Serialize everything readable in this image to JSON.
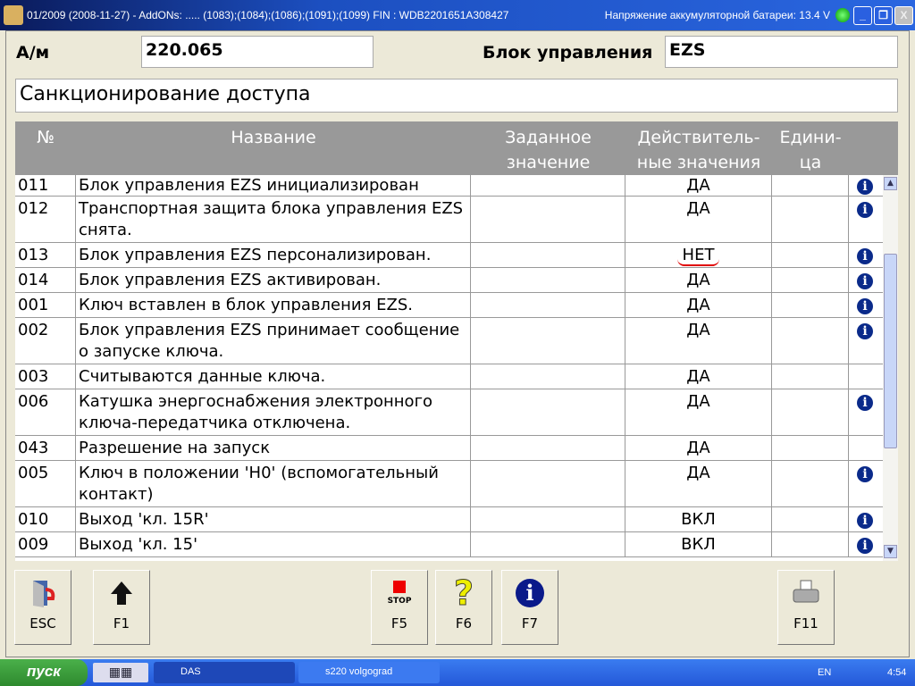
{
  "window": {
    "title": "01/2009 (2008-11-27) - AddONs: ..... (1083);(1084);(1086);(1091);(1099)  FIN : WDB2201651A308427",
    "battery": "Напряжение аккумуляторной батареи: 13.4 V"
  },
  "header": {
    "am_label": "А/м",
    "am_value": "220.065",
    "ecu_label": "Блок управления",
    "ecu_value": "EZS",
    "section": "Санкционирование доступа"
  },
  "table": {
    "columns": [
      "№",
      "Название",
      "Заданное значение",
      "Действитель-ные значения",
      "Едини-ца"
    ],
    "col_lines": [
      [
        "№"
      ],
      [
        "Название"
      ],
      [
        "Заданное",
        "значение"
      ],
      [
        "Действитель-",
        "ные значения"
      ],
      [
        "Едини-",
        "ца"
      ]
    ],
    "rows": [
      {
        "no": "011",
        "name": "Блок управления EZS инициализирован",
        "set": "",
        "actual": "ДА",
        "unit": "",
        "info": true
      },
      {
        "no": "012",
        "name": "Транспортная защита блока управления EZS снята.",
        "set": "",
        "actual": "ДА",
        "unit": "",
        "info": true
      },
      {
        "no": "013",
        "name": "Блок управления EZS персонализирован.",
        "set": "",
        "actual": "НЕТ",
        "unit": "",
        "info": true,
        "marked": true
      },
      {
        "no": "014",
        "name": "Блок управления EZS активирован.",
        "set": "",
        "actual": "ДА",
        "unit": "",
        "info": true
      },
      {
        "no": "001",
        "name": "Ключ вставлен в блок управления EZS.",
        "set": "",
        "actual": "ДА",
        "unit": "",
        "info": true
      },
      {
        "no": "002",
        "name": "Блок управления EZS принимает сообщение о запуске ключа.",
        "set": "",
        "actual": "ДА",
        "unit": "",
        "info": true
      },
      {
        "no": "003",
        "name": "Считываются данные ключа.",
        "set": "",
        "actual": "ДА",
        "unit": "",
        "info": false
      },
      {
        "no": "006",
        "name": "Катушка энергоснабжения электронного ключа-передатчика отключена.",
        "set": "",
        "actual": "ДА",
        "unit": "",
        "info": true
      },
      {
        "no": "043",
        "name": "Разрешение на запуск",
        "set": "",
        "actual": "ДА",
        "unit": "",
        "info": false
      },
      {
        "no": "005",
        "name": "Ключ в положении 'H0' (вспомогательный контакт)",
        "set": "",
        "actual": "ДА",
        "unit": "",
        "info": true
      },
      {
        "no": "010",
        "name": "Выход 'кл. 15R'",
        "set": "",
        "actual": "ВКЛ",
        "unit": "",
        "info": true
      },
      {
        "no": "009",
        "name": "Выход 'кл. 15'",
        "set": "",
        "actual": "ВКЛ",
        "unit": "",
        "info": true
      }
    ]
  },
  "buttons": [
    {
      "key": "ESC",
      "icon": "exit-door-icon"
    },
    {
      "key": "F1",
      "icon": "arrow-up-icon"
    },
    {
      "key": "F5",
      "icon": "stop-icon",
      "caption": "STOP"
    },
    {
      "key": "F6",
      "icon": "help-icon"
    },
    {
      "key": "F7",
      "icon": "info-icon"
    },
    {
      "key": "F11",
      "icon": "printer-icon"
    }
  ],
  "taskbar": {
    "start": "пуск",
    "tasks": [
      "DAS",
      "s220 volgograd"
    ],
    "lang": "EN",
    "time": "4:54"
  },
  "colors": {
    "header_bg": "#999999",
    "mark": "#e00000"
  }
}
